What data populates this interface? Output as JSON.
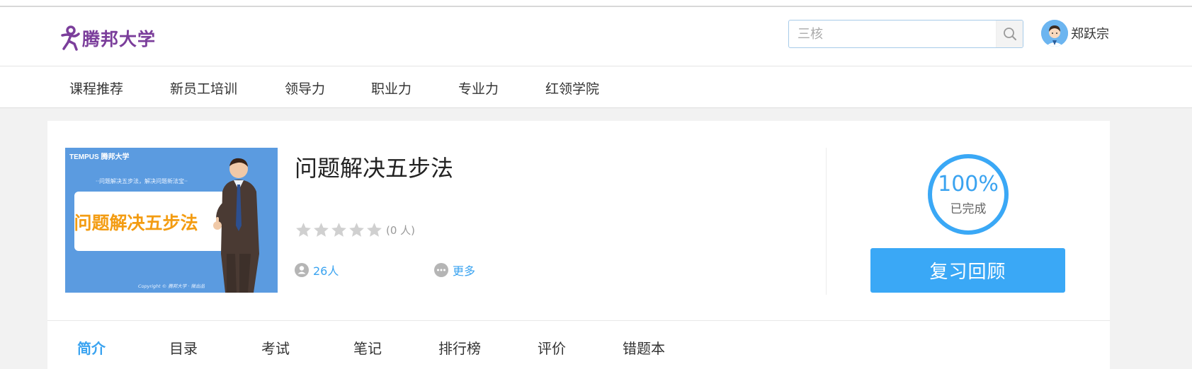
{
  "header": {
    "logo_text": "腾邦大学",
    "search": {
      "value": "",
      "placeholder": "三核"
    },
    "user_name": "郑跃宗"
  },
  "nav": {
    "items": [
      "课程推荐",
      "新员工培训",
      "领导力",
      "职业力",
      "专业力",
      "红领学院"
    ]
  },
  "course": {
    "title": "问题解决五步法",
    "cover": {
      "brand": "TEMPUS 腾邦大学",
      "tagline": "··问题解决五步法，解决问题新法宝··",
      "headline": "问题解决五步法",
      "copyright": "Copyright © 腾邦大学 · 微出品"
    },
    "rating": {
      "stars": 0,
      "max_stars": 5,
      "count_text": "(0 人)"
    },
    "learners_text": "26人",
    "more_label": "更多",
    "progress": {
      "percent": 100,
      "value_text": "100%",
      "status_text": "已完成"
    },
    "review_button": "复习回顾"
  },
  "tabs": {
    "items": [
      "简介",
      "目录",
      "考试",
      "笔记",
      "排行榜",
      "评价",
      "错题本"
    ],
    "active_index": 0
  },
  "colors": {
    "accent": "#3aa3f0",
    "button": "#3aa8f6",
    "brand": "#7b3e9b",
    "cover_bg": "#5b9be0",
    "cover_headline": "#f39c12"
  }
}
